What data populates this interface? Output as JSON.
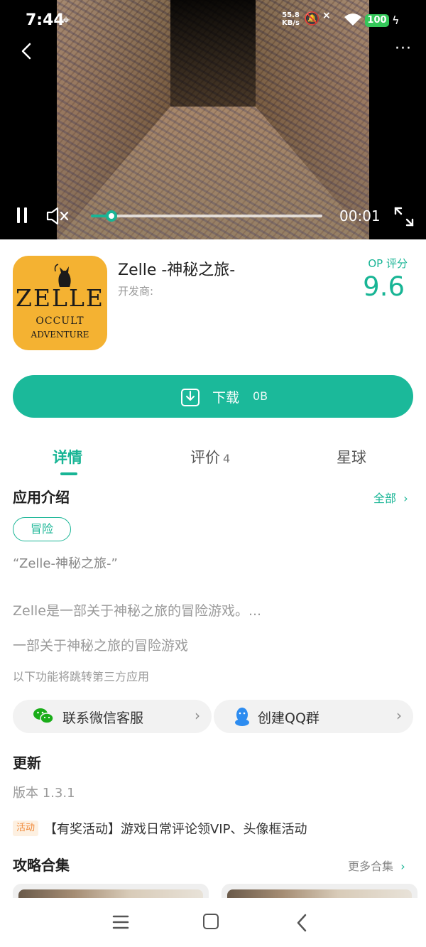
{
  "status_bar": {
    "time": "7:44",
    "network_speed_value": "55.8",
    "network_speed_unit": "KB/s",
    "battery": "100",
    "icons": [
      "location-icon",
      "mute-icon",
      "wifi-icon",
      "battery-icon",
      "charging-icon"
    ]
  },
  "video": {
    "elapsed": "00:01",
    "progress": 0.09
  },
  "app": {
    "title": "Zelle -神秘之旅-",
    "developer_label": "开发商:",
    "score_label": "OP 评分",
    "score": "9.6",
    "icon_text": [
      "ZELLE",
      "OCCULT",
      "ADVENTURE"
    ]
  },
  "download": {
    "label": "下载",
    "size": "0B"
  },
  "tabs": [
    {
      "label": "详情",
      "active": true
    },
    {
      "label": "评价",
      "count": "4"
    },
    {
      "label": "星球"
    }
  ],
  "intro": {
    "title": "应用介绍",
    "see_all": "全部",
    "tag": "冒险",
    "quote": "“Zelle-神秘之旅-”",
    "description": "Zelle是一部关于神秘之旅的冒险游戏。...",
    "summary": "一部关于神秘之旅的冒险游戏",
    "third_party_note": "以下功能将跳转第三方应用"
  },
  "actions": {
    "wechat_label": "联系微信客服",
    "qq_label": "创建QQ群"
  },
  "update": {
    "title": "更新",
    "version": "版本 1.3.1",
    "event_badge": "活动",
    "event_text": "【有奖活动】游戏日常评论领VIP、头像框活动"
  },
  "guides": {
    "title": "攻略合集",
    "more": "更多合集"
  },
  "colors": {
    "accent": "#18b595",
    "icon_bg": "#f4b232",
    "event_badge": "#f0893a"
  }
}
